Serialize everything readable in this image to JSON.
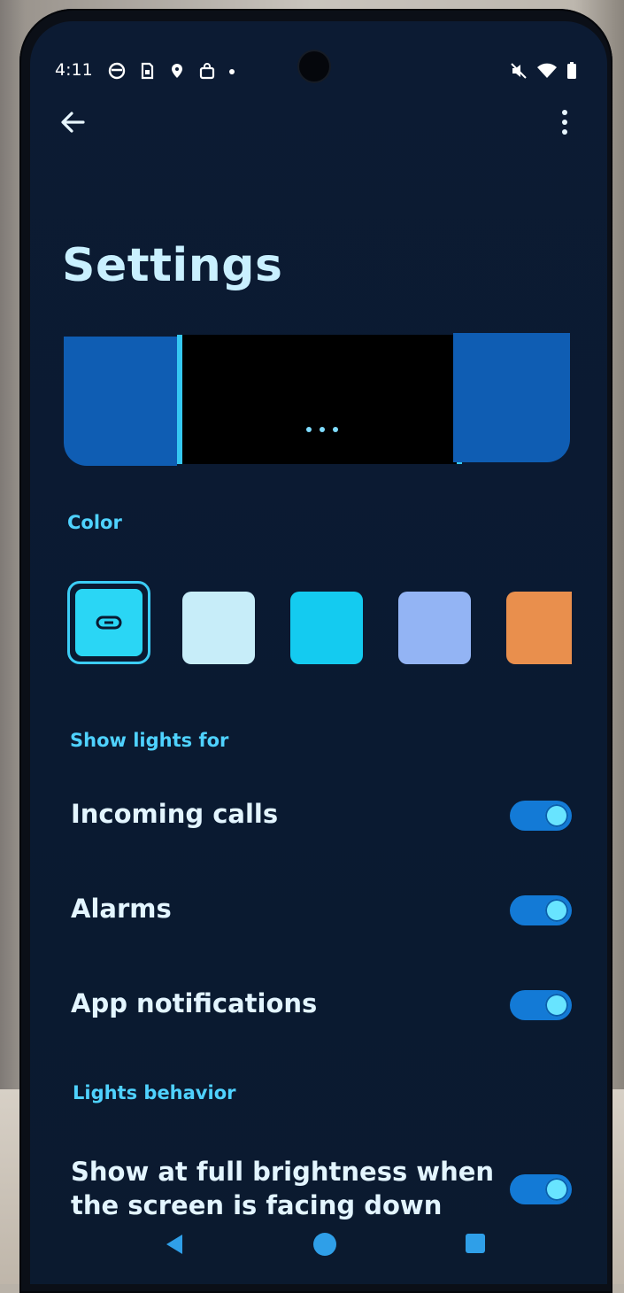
{
  "status_bar": {
    "time": "4:11",
    "left_icons": [
      "circle-app-icon",
      "sim-card-icon",
      "location-pin-icon",
      "shopping-bag-icon",
      "more-dot-icon"
    ],
    "right_icons": [
      "mute-icon",
      "wifi-icon",
      "battery-icon"
    ]
  },
  "header": {
    "title": "Settings"
  },
  "preview": {
    "dots": "• • •"
  },
  "colors": {
    "section_label": "Color",
    "swatches": [
      {
        "color": "#2ad6f5",
        "selected": true,
        "icon": "link-icon"
      },
      {
        "color": "#c7edf9",
        "selected": false
      },
      {
        "color": "#14cbf0",
        "selected": false
      },
      {
        "color": "#93b4f4",
        "selected": false
      },
      {
        "color": "#e98f4d",
        "selected": false
      }
    ]
  },
  "show_lights": {
    "section_label": "Show lights for",
    "items": [
      {
        "label": "Incoming calls",
        "enabled": true
      },
      {
        "label": "Alarms",
        "enabled": true
      },
      {
        "label": "App notifications",
        "enabled": true
      }
    ]
  },
  "behavior": {
    "section_label": "Lights behavior",
    "full_brightness": {
      "line1": "Show at full brightness when",
      "line2": "the screen is facing down",
      "enabled": true
    }
  }
}
